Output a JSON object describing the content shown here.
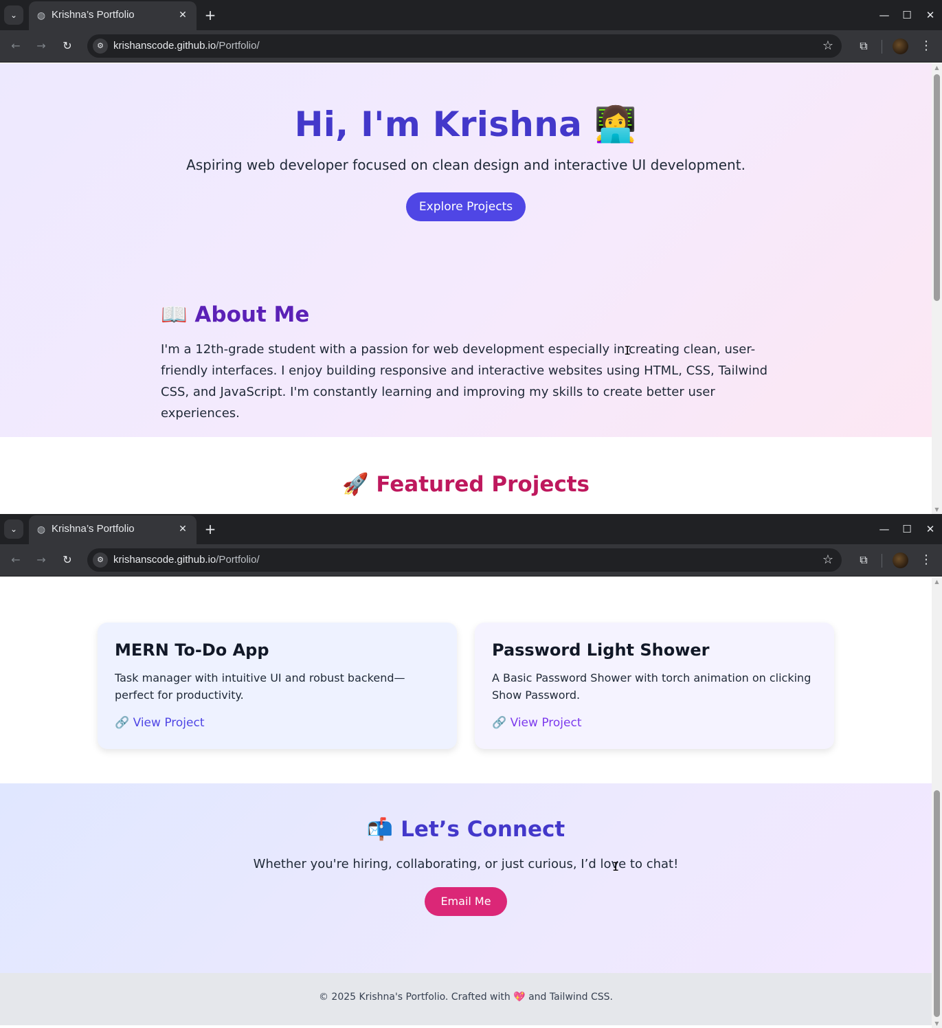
{
  "browser": {
    "tab_title": "Krishna’s Portfolio",
    "url_host": "krishanscode.github.io",
    "url_path": "/Portfolio/",
    "icons": {
      "tab_list": "chevron-down-icon",
      "favicon": "globe-icon",
      "tab_close": "close-icon",
      "new_tab": "plus-icon",
      "minimize": "minimize-icon",
      "maximize": "maximize-icon",
      "close_window": "close-icon",
      "back": "back-arrow-icon",
      "forward": "forward-arrow-icon",
      "reload": "reload-icon",
      "site_info": "tune-icon",
      "bookmark": "star-icon",
      "extensions": "puzzle-icon",
      "menu": "more-vert-icon"
    }
  },
  "hero": {
    "title": "Hi, I'm Krishna 👩‍💻",
    "tagline": "Aspiring web developer focused on clean design and interactive UI development.",
    "cta_label": "Explore Projects"
  },
  "about": {
    "title": "📖 About Me",
    "text": "I'm a 12th-grade student with a passion for web development especially in creating clean, user-friendly interfaces. I enjoy building responsive and interactive websites using HTML, CSS, Tailwind CSS, and JavaScript. I'm constantly learning and improving my skills to create better user experiences."
  },
  "projects": {
    "title": "🚀 Featured Projects",
    "items": [
      {
        "title": "MERN To-Do App",
        "description": "Task manager with intuitive UI and robust backend—perfect for productivity.",
        "link_label": "🔗 View Project"
      },
      {
        "title": "Password Light Shower",
        "description": "A Basic Password Shower with torch animation on clicking Show Password.",
        "link_label": "🔗 View Project"
      }
    ]
  },
  "connect": {
    "title": "📬 Let’s Connect",
    "text": "Whether you're hiring, collaborating, or just curious, I’d love to chat!",
    "button_label": "Email Me"
  },
  "footer": {
    "text": "© 2025 Krishna's Portfolio. Crafted with 💖 and Tailwind CSS."
  },
  "colors": {
    "primary": "#4f46e5",
    "accent_pink": "#db2777",
    "heading_purple": "#5b21b6"
  }
}
